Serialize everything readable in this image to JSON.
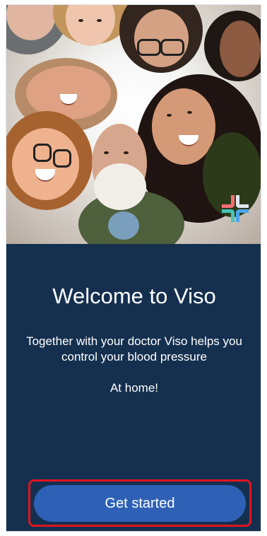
{
  "hero": {
    "photo_description": "group of smiling people in a circle looking down",
    "logo_icon": "viso-logo-icon"
  },
  "welcome": {
    "title": "Welcome to Viso",
    "subtitle": "Together with your doctor Viso helps you control your blood pressure",
    "tagline": "At home!"
  },
  "actions": {
    "primary_label": "Get started"
  },
  "colors": {
    "background": "#15304f",
    "button": "#2e61b5",
    "highlight": "#e1141e",
    "logo_red": "#f26d73",
    "logo_blue": "#4ba3e7",
    "logo_teal": "#45c4b7"
  }
}
